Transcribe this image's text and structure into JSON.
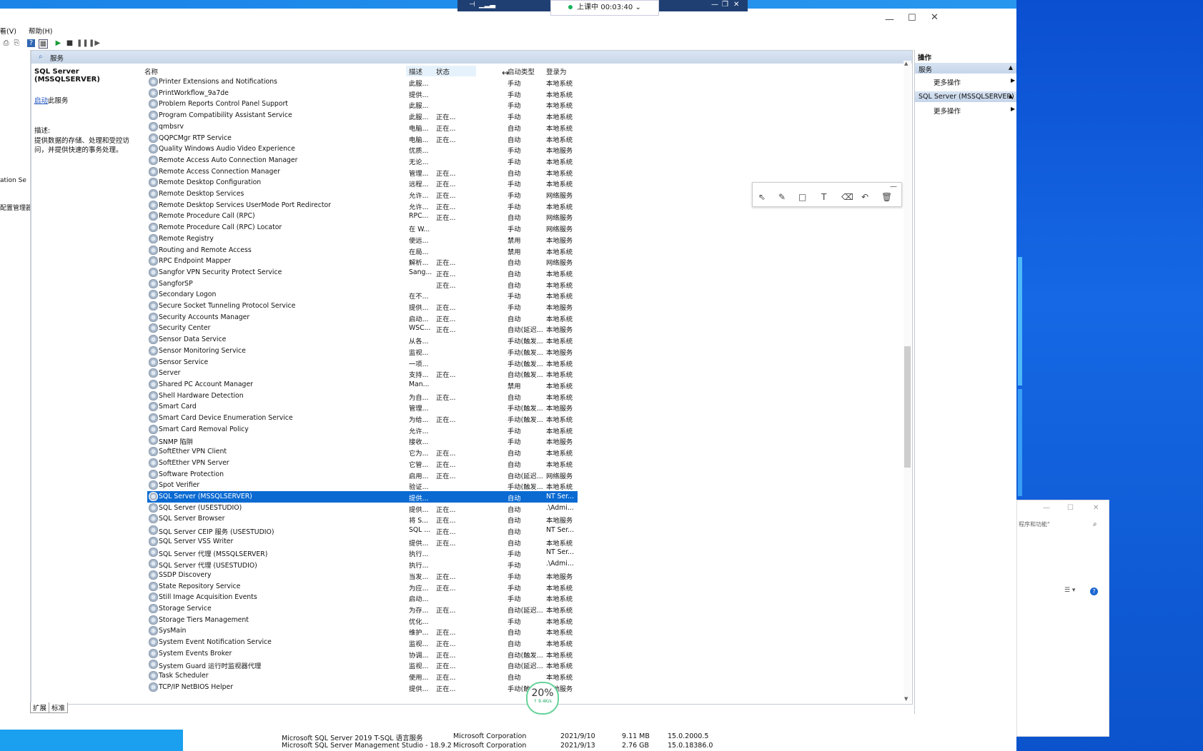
{
  "meeting": {
    "status": "上课中 00:03:40",
    "chevron": "⌄"
  },
  "menu": {
    "view": "查看(V)",
    "help": "帮助(H)"
  },
  "left_nav": {
    "item1": "ation Se",
    "item2": "配置管理器"
  },
  "header": {
    "title": "服务"
  },
  "detail": {
    "service_name": "SQL Server (MSSQLSERVER)",
    "start_link": "启动",
    "start_suffix": "此服务",
    "desc_label": "描述:",
    "desc_text": "提供数据的存储、处理和受控访问，并提供快速的事务处理。"
  },
  "columns": {
    "name": "名称",
    "desc": "描述",
    "state": "状态",
    "start": "启动类型",
    "logon": "登录为"
  },
  "rows": [
    {
      "name": "Printer Extensions and Notifications",
      "desc": "此服...",
      "state": "",
      "start": "手动",
      "logon": "本地系统"
    },
    {
      "name": "PrintWorkflow_9a7de",
      "desc": "提供...",
      "state": "",
      "start": "手动",
      "logon": "本地系统"
    },
    {
      "name": "Problem Reports Control Panel Support",
      "desc": "此服...",
      "state": "",
      "start": "手动",
      "logon": "本地系统"
    },
    {
      "name": "Program Compatibility Assistant Service",
      "desc": "此服...",
      "state": "正在...",
      "start": "手动",
      "logon": "本地系统"
    },
    {
      "name": "qmbsrv",
      "desc": "电脑...",
      "state": "正在...",
      "start": "自动",
      "logon": "本地系统"
    },
    {
      "name": "QQPCMgr RTP Service",
      "desc": "电脑...",
      "state": "正在...",
      "start": "自动",
      "logon": "本地系统"
    },
    {
      "name": "Quality Windows Audio Video Experience",
      "desc": "优质...",
      "state": "",
      "start": "手动",
      "logon": "本地服务"
    },
    {
      "name": "Remote Access Auto Connection Manager",
      "desc": "无论...",
      "state": "",
      "start": "手动",
      "logon": "本地系统"
    },
    {
      "name": "Remote Access Connection Manager",
      "desc": "管理...",
      "state": "正在...",
      "start": "自动",
      "logon": "本地系统"
    },
    {
      "name": "Remote Desktop Configuration",
      "desc": "远程...",
      "state": "正在...",
      "start": "手动",
      "logon": "本地系统"
    },
    {
      "name": "Remote Desktop Services",
      "desc": "允许...",
      "state": "正在...",
      "start": "手动",
      "logon": "网络服务"
    },
    {
      "name": "Remote Desktop Services UserMode Port Redirector",
      "desc": "允许...",
      "state": "正在...",
      "start": "手动",
      "logon": "本地系统"
    },
    {
      "name": "Remote Procedure Call (RPC)",
      "desc": "RPC...",
      "state": "正在...",
      "start": "自动",
      "logon": "网络服务"
    },
    {
      "name": "Remote Procedure Call (RPC) Locator",
      "desc": "在 W...",
      "state": "",
      "start": "手动",
      "logon": "网络服务"
    },
    {
      "name": "Remote Registry",
      "desc": "使远...",
      "state": "",
      "start": "禁用",
      "logon": "本地服务"
    },
    {
      "name": "Routing and Remote Access",
      "desc": "在局...",
      "state": "",
      "start": "禁用",
      "logon": "本地系统"
    },
    {
      "name": "RPC Endpoint Mapper",
      "desc": "解析...",
      "state": "正在...",
      "start": "自动",
      "logon": "网络服务"
    },
    {
      "name": "Sangfor VPN Security Protect Service",
      "desc": "Sang...",
      "state": "正在...",
      "start": "自动",
      "logon": "本地系统"
    },
    {
      "name": "SangforSP",
      "desc": "",
      "state": "正在...",
      "start": "自动",
      "logon": "本地系统"
    },
    {
      "name": "Secondary Logon",
      "desc": "在不...",
      "state": "",
      "start": "手动",
      "logon": "本地系统"
    },
    {
      "name": "Secure Socket Tunneling Protocol Service",
      "desc": "提供...",
      "state": "正在...",
      "start": "手动",
      "logon": "本地服务"
    },
    {
      "name": "Security Accounts Manager",
      "desc": "启动...",
      "state": "正在...",
      "start": "自动",
      "logon": "本地系统"
    },
    {
      "name": "Security Center",
      "desc": "WSC...",
      "state": "正在...",
      "start": "自动(延迟...",
      "logon": "本地服务"
    },
    {
      "name": "Sensor Data Service",
      "desc": "从各...",
      "state": "",
      "start": "手动(触发...",
      "logon": "本地系统"
    },
    {
      "name": "Sensor Monitoring Service",
      "desc": "监视...",
      "state": "",
      "start": "手动(触发...",
      "logon": "本地服务"
    },
    {
      "name": "Sensor Service",
      "desc": "一项...",
      "state": "",
      "start": "手动(触发...",
      "logon": "本地系统"
    },
    {
      "name": "Server",
      "desc": "支持...",
      "state": "正在...",
      "start": "自动(触发...",
      "logon": "本地系统"
    },
    {
      "name": "Shared PC Account Manager",
      "desc": "Man...",
      "state": "",
      "start": "禁用",
      "logon": "本地系统"
    },
    {
      "name": "Shell Hardware Detection",
      "desc": "为自...",
      "state": "正在...",
      "start": "自动",
      "logon": "本地系统"
    },
    {
      "name": "Smart Card",
      "desc": "管理...",
      "state": "",
      "start": "手动(触发...",
      "logon": "本地服务"
    },
    {
      "name": "Smart Card Device Enumeration Service",
      "desc": "为给...",
      "state": "正在...",
      "start": "手动(触发...",
      "logon": "本地系统"
    },
    {
      "name": "Smart Card Removal Policy",
      "desc": "允许...",
      "state": "",
      "start": "手动",
      "logon": "本地系统"
    },
    {
      "name": "SNMP 陷阱",
      "desc": "接收...",
      "state": "",
      "start": "手动",
      "logon": "本地服务"
    },
    {
      "name": "SoftEther VPN Client",
      "desc": "它为...",
      "state": "正在...",
      "start": "自动",
      "logon": "本地系统"
    },
    {
      "name": "SoftEther VPN Server",
      "desc": "它管...",
      "state": "正在...",
      "start": "自动",
      "logon": "本地系统"
    },
    {
      "name": "Software Protection",
      "desc": "启用...",
      "state": "正在...",
      "start": "自动(延迟...",
      "logon": "网络服务"
    },
    {
      "name": "Spot Verifier",
      "desc": "验证...",
      "state": "",
      "start": "手动(触发...",
      "logon": "本地系统"
    },
    {
      "name": "SQL Server (MSSQLSERVER)",
      "desc": "提供...",
      "state": "",
      "start": "自动",
      "logon": "NT Ser...",
      "selected": true
    },
    {
      "name": "SQL Server (USESTUDIO)",
      "desc": "提供...",
      "state": "正在...",
      "start": "自动",
      "logon": ".\\Admi..."
    },
    {
      "name": "SQL Server Browser",
      "desc": "将 S...",
      "state": "正在...",
      "start": "自动",
      "logon": "本地服务"
    },
    {
      "name": "SQL Server CEIP 服务 (USESTUDIO)",
      "desc": "SQL ...",
      "state": "正在...",
      "start": "自动",
      "logon": "NT Ser..."
    },
    {
      "name": "SQL Server VSS Writer",
      "desc": "提供...",
      "state": "正在...",
      "start": "自动",
      "logon": "本地系统"
    },
    {
      "name": "SQL Server 代理 (MSSQLSERVER)",
      "desc": "执行...",
      "state": "",
      "start": "手动",
      "logon": "NT Ser..."
    },
    {
      "name": "SQL Server 代理 (USESTUDIO)",
      "desc": "执行...",
      "state": "",
      "start": "手动",
      "logon": ".\\Admi..."
    },
    {
      "name": "SSDP Discovery",
      "desc": "当发...",
      "state": "正在...",
      "start": "手动",
      "logon": "本地服务"
    },
    {
      "name": "State Repository Service",
      "desc": "为应...",
      "state": "正在...",
      "start": "手动",
      "logon": "本地系统"
    },
    {
      "name": "Still Image Acquisition Events",
      "desc": "启动...",
      "state": "",
      "start": "手动",
      "logon": "本地系统"
    },
    {
      "name": "Storage Service",
      "desc": "为存...",
      "state": "正在...",
      "start": "自动(延迟...",
      "logon": "本地系统"
    },
    {
      "name": "Storage Tiers Management",
      "desc": "优化...",
      "state": "",
      "start": "手动",
      "logon": "本地系统"
    },
    {
      "name": "SysMain",
      "desc": "维护...",
      "state": "正在...",
      "start": "自动",
      "logon": "本地系统"
    },
    {
      "name": "System Event Notification Service",
      "desc": "监视...",
      "state": "正在...",
      "start": "自动",
      "logon": "本地系统"
    },
    {
      "name": "System Events Broker",
      "desc": "协调...",
      "state": "正在...",
      "start": "自动(触发...",
      "logon": "本地系统"
    },
    {
      "name": "System Guard 运行时监视器代理",
      "desc": "监视...",
      "state": "正在...",
      "start": "自动(延迟...",
      "logon": "本地系统"
    },
    {
      "name": "Task Scheduler",
      "desc": "使用...",
      "state": "正在...",
      "start": "自动",
      "logon": "本地系统"
    },
    {
      "name": "TCP/IP NetBIOS Helper",
      "desc": "提供...",
      "state": "正在...",
      "start": "手动(触发...",
      "logon": "本地服务"
    }
  ],
  "tabs": {
    "extended": "扩展",
    "standard": "标准"
  },
  "actions": {
    "title": "操作",
    "section1": "服务",
    "more1": "更多操作",
    "section2": "SQL Server (MSSQLSERVER)",
    "more2": "更多操作"
  },
  "speed": {
    "percent": "20%",
    "rate": "↑ 9.4K/s"
  },
  "subwin": {
    "search_placeholder": "程序和功能\""
  },
  "programs": [
    {
      "name": "Microsoft SQL Server 2019 T-SQL 语言服务",
      "publisher": "Microsoft Corporation",
      "date": "2021/9/10",
      "size": "9.11 MB",
      "version": "15.0.2000.5"
    },
    {
      "name": "Microsoft SQL Server Management Studio - 18.9.2",
      "publisher": "Microsoft Corporation",
      "date": "2021/9/13",
      "size": "2.76 GB",
      "version": "15.0.18386.0"
    }
  ],
  "colors": {
    "selected_row": "#0a6ad2",
    "header_blue": "#c8d6e8",
    "desktop": "#1565d8"
  }
}
